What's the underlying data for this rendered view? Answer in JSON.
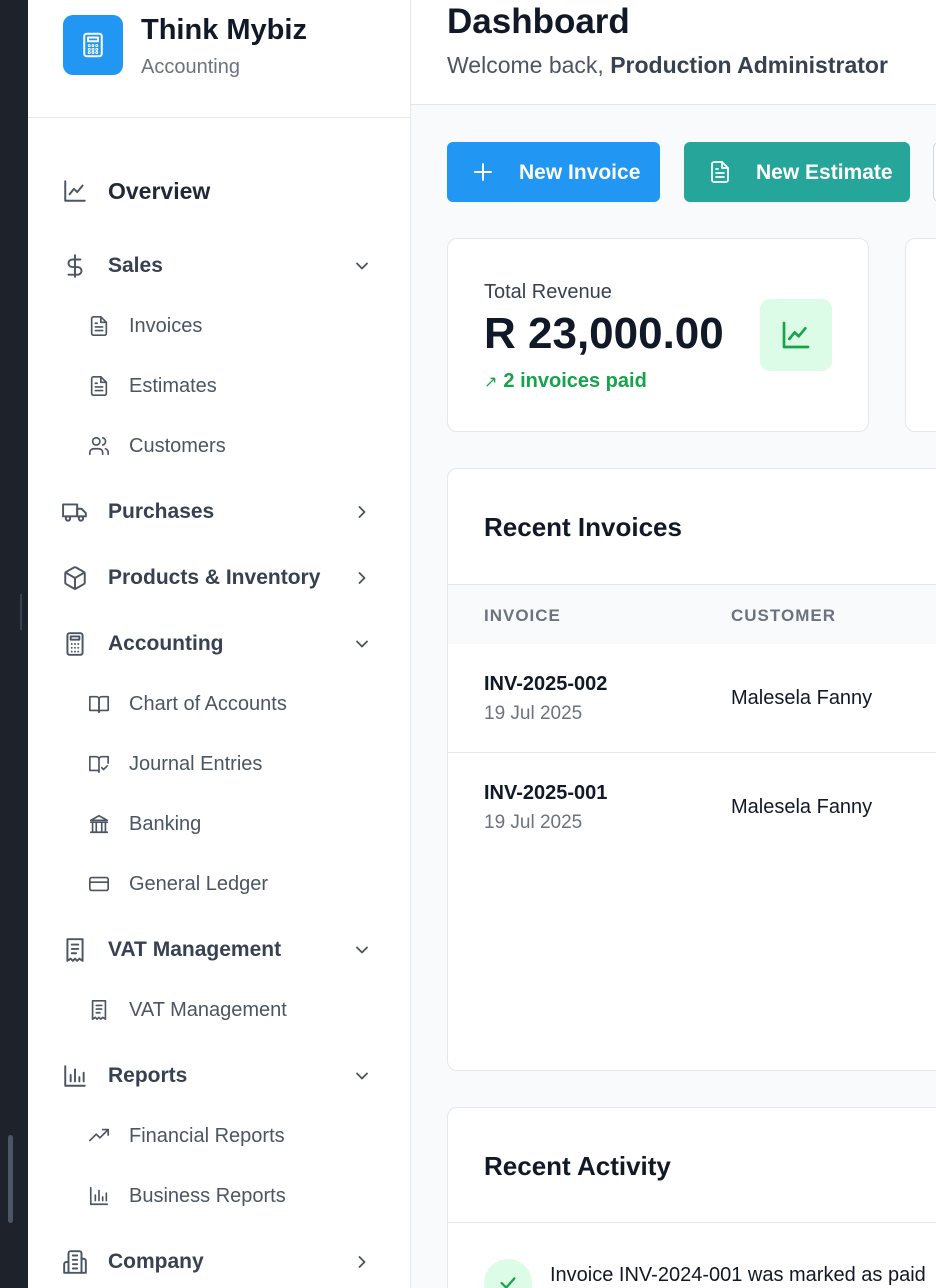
{
  "brand": {
    "name": "Think Mybiz",
    "subtitle": "Accounting"
  },
  "sidebar": {
    "overview": "Overview",
    "sales": {
      "label": "Sales",
      "items": [
        "Invoices",
        "Estimates",
        "Customers"
      ]
    },
    "purchases": "Purchases",
    "products": "Products & Inventory",
    "accounting": {
      "label": "Accounting",
      "items": [
        "Chart of Accounts",
        "Journal Entries",
        "Banking",
        "General Ledger"
      ]
    },
    "vat": {
      "label": "VAT Management",
      "items": [
        "VAT Management"
      ]
    },
    "reports": {
      "label": "Reports",
      "items": [
        "Financial Reports",
        "Business Reports"
      ]
    },
    "company": "Company"
  },
  "header": {
    "title": "Dashboard",
    "welcome_prefix": "Welcome back,",
    "user": "Production Administrator"
  },
  "actions": {
    "new_invoice": "New Invoice",
    "new_estimate": "New Estimate"
  },
  "revenue": {
    "label": "Total Revenue",
    "value": "R 23,000.00",
    "trend_icon": "↗",
    "trend": "2 invoices paid"
  },
  "recent_invoices": {
    "title": "Recent Invoices",
    "columns": [
      "INVOICE",
      "CUSTOMER"
    ],
    "rows": [
      {
        "number": "INV-2025-002",
        "date": "19 Jul 2025",
        "customer": "Malesela Fanny"
      },
      {
        "number": "INV-2025-001",
        "date": "19 Jul 2025",
        "customer": "Malesela Fanny"
      }
    ]
  },
  "recent_activity": {
    "title": "Recent Activity",
    "items": [
      "Invoice INV-2024-001 was marked as paid"
    ]
  },
  "colors": {
    "primary": "#2196f3",
    "teal": "#26a69a",
    "success": "#16a34a",
    "success_bg": "#dcfce7"
  }
}
